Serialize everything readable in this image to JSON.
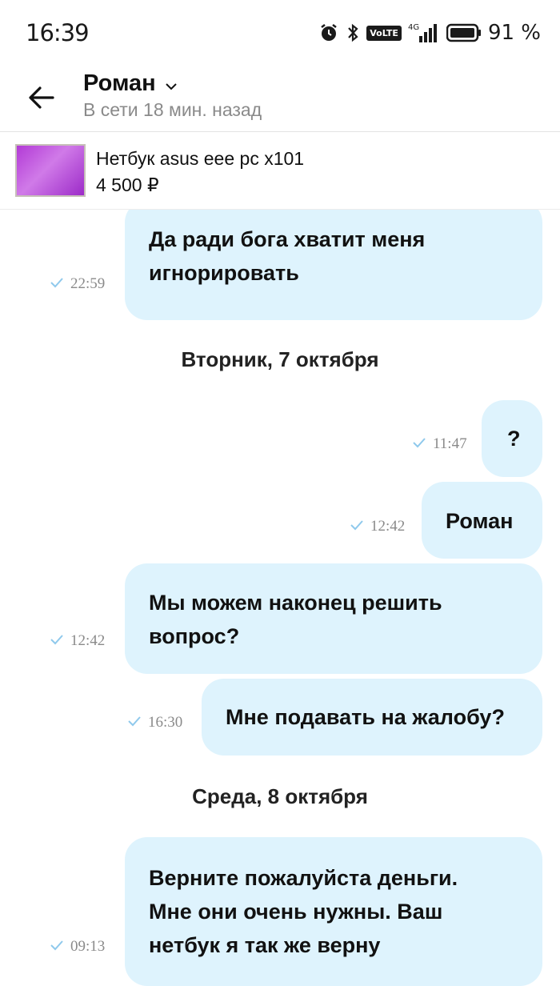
{
  "status_bar": {
    "time": "16:39",
    "network": "4G",
    "volte": "VoLTE",
    "battery": "91 %"
  },
  "header": {
    "contact_name": "Роман",
    "contact_status": "В сети 18 мин. назад"
  },
  "listing": {
    "title": "Нетбук asus eee pc x101",
    "price": "4 500 ₽"
  },
  "messages": [
    {
      "text": "Да ради бога хватит меня\nигнорировать",
      "time": "22:59"
    },
    {
      "date": "Вторник, 7 октября"
    },
    {
      "text": "?",
      "time": "11:47"
    },
    {
      "text": "Роман",
      "time": "12:42"
    },
    {
      "text": "Мы можем наконец решить\nвопрос?",
      "time": "12:42"
    },
    {
      "text": "Мне подавать на жалобу?",
      "time": "16:30"
    },
    {
      "date": "Среда, 8 октября"
    },
    {
      "text": "Верните пожалуйста деньги.\nМне они очень нужны. Ваш\nнетбук я так же верну",
      "time": "09:13"
    }
  ],
  "colors": {
    "bubble": "#def3fd",
    "check": "#8fc9ec",
    "muted": "#8a8a8a"
  },
  "icons": [
    "alarm-icon",
    "bluetooth-icon",
    "signal-icon",
    "battery-icon",
    "back-arrow-icon",
    "chevron-down-icon",
    "check-icon"
  ]
}
